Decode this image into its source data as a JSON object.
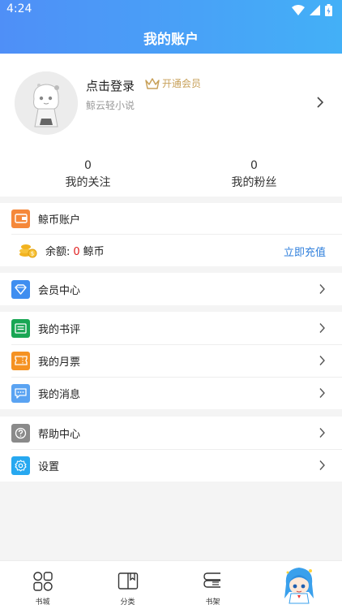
{
  "status_bar": {
    "time": "4:24"
  },
  "header": {
    "title": "我的账户"
  },
  "profile": {
    "login_text": "点击登录",
    "vip_label": "开通会员",
    "subtitle": "鲸云轻小说",
    "following_count": "0",
    "following_label": "我的关注",
    "fans_count": "0",
    "fans_label": "我的粉丝"
  },
  "wallet": {
    "title": "鲸币账户",
    "balance_prefix": "余额:",
    "balance_value": "0",
    "balance_unit": "鲸币",
    "recharge_label": "立即充值"
  },
  "menu": {
    "member_center": "会员中心",
    "my_reviews": "我的书评",
    "my_monthly_tickets": "我的月票",
    "my_messages": "我的消息",
    "help_center": "帮助中心",
    "settings": "设置"
  },
  "bottom_nav": {
    "items": [
      {
        "label": "书城",
        "icon": "bookstore-icon"
      },
      {
        "label": "分类",
        "icon": "category-icon"
      },
      {
        "label": "书架",
        "icon": "bookshelf-icon"
      },
      {
        "label": "",
        "icon": "mascot-icon"
      }
    ]
  },
  "colors": {
    "header_start": "#4f8ff7",
    "header_end": "#43b0f7",
    "vip_gold": "#c8a15a",
    "recharge_blue": "#2f7fdc",
    "balance_red": "#e02020"
  }
}
